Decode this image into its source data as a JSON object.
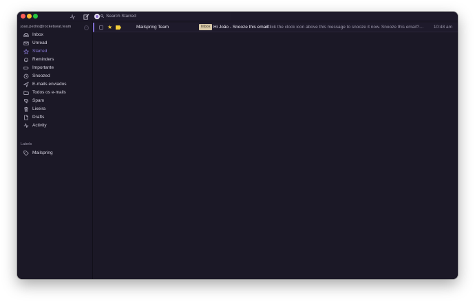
{
  "window": {
    "search": {
      "placeholder": "Search Starred"
    }
  },
  "sidebar": {
    "account": "joao.pedro@rocketseat.team",
    "items": [
      {
        "label": "Inbox",
        "icon": "inbox-icon"
      },
      {
        "label": "Unread",
        "icon": "envelope-icon"
      },
      {
        "label": "Starred",
        "icon": "star-icon",
        "selected": true
      },
      {
        "label": "Reminders",
        "icon": "bell-icon"
      },
      {
        "label": "Importante",
        "icon": "label-tag-icon"
      },
      {
        "label": "Snoozed",
        "icon": "clock-icon"
      },
      {
        "label": "E-mails enviados",
        "icon": "send-icon"
      },
      {
        "label": "Todos os e-mails",
        "icon": "folder-icon"
      },
      {
        "label": "Spam",
        "icon": "thumbs-down-icon"
      },
      {
        "label": "Lixeira",
        "icon": "trash-icon"
      },
      {
        "label": "Drafts",
        "icon": "document-icon"
      },
      {
        "label": "Activity",
        "icon": "activity-icon"
      }
    ],
    "labels_heading": "Labels",
    "labels": [
      {
        "label": "Mailspring",
        "icon": "tag-icon"
      }
    ]
  },
  "messages": [
    {
      "sender": "Mailspring Team",
      "label": "Inbox",
      "subject": "Hi João - Snooze this email!",
      "snippet": "Click the clock icon above this message to snooze it now. Snooze this email? Thanks for t...",
      "time": "10:48 am",
      "starred": true
    }
  ],
  "colors": {
    "accent": "#8a7ad6",
    "star": "#f5cf3b",
    "background": "#1b1826",
    "label_pill": "#d6c7a6"
  }
}
